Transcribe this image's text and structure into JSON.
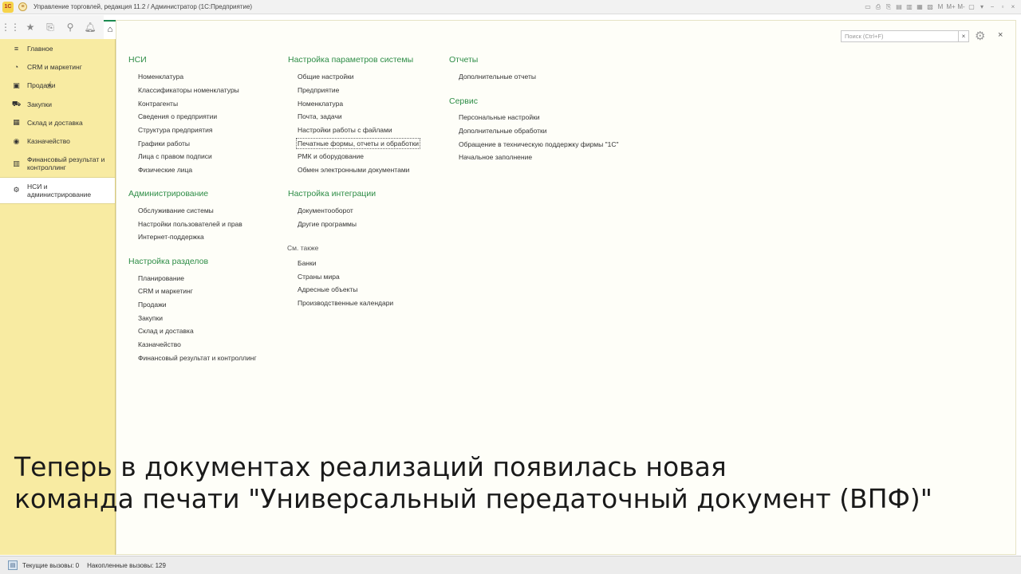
{
  "titlebar": {
    "logo": "1С",
    "title": "Управление торговлей, редакция 11.2 / Администратор  (1С:Предприятие)",
    "icons": [
      "▭",
      "⎙",
      "⎘",
      "▤",
      "▥",
      "▦",
      "▧",
      "M",
      "M+",
      "M-",
      "▢",
      "▾",
      "−",
      "▫",
      "×"
    ]
  },
  "toolbar": {
    "icons": [
      "apps-icon",
      "star-icon",
      "history-icon",
      "search-icon",
      "bell-icon"
    ]
  },
  "sidebar": {
    "items": [
      {
        "label": "Главное",
        "icon": "≡"
      },
      {
        "label": "CRM и маркетинг",
        "icon": "◔"
      },
      {
        "label": "Продажи",
        "icon": "▣"
      },
      {
        "label": "Закупки",
        "icon": "⛟"
      },
      {
        "label": "Склад и доставка",
        "icon": "▦"
      },
      {
        "label": "Казначейство",
        "icon": "◉"
      },
      {
        "label": "Финансовый результат и контроллинг",
        "icon": "▥"
      },
      {
        "label": "НСИ и администрирование",
        "icon": "⚙"
      }
    ]
  },
  "search": {
    "placeholder": "Поиск (Ctrl+F)",
    "clear": "×"
  },
  "main_close": "×",
  "sections": {
    "nsi": {
      "title": "НСИ",
      "items": [
        "Номенклатура",
        "Классификаторы номенклатуры",
        "Контрагенты",
        "Сведения о предприятии",
        "Структура предприятия",
        "Графики работы",
        "Лица с правом подписи",
        "Физические лица"
      ]
    },
    "admin": {
      "title": "Администрирование",
      "items": [
        "Обслуживание системы",
        "Настройки пользователей и прав",
        "Интернет-поддержка"
      ]
    },
    "razdely": {
      "title": "Настройка разделов",
      "items": [
        "Планирование",
        "CRM и маркетинг",
        "Продажи",
        "Закупки",
        "Склад и доставка",
        "Казначейство",
        "Финансовый результат и контроллинг"
      ]
    },
    "params": {
      "title": "Настройка параметров системы",
      "items": [
        "Общие настройки",
        "Предприятие",
        "Номенклатура",
        "Почта, задачи",
        "Настройки работы с файлами",
        "Печатные формы, отчеты и обработки",
        "РМК и оборудование",
        "Обмен электронными документами"
      ]
    },
    "integr": {
      "title": "Настройка интеграции",
      "items": [
        "Документооборот",
        "Другие программы"
      ]
    },
    "see_also": {
      "title": "См. также",
      "items": [
        "Банки",
        "Страны мира",
        "Адресные объекты",
        "Производственные календари"
      ]
    },
    "reports": {
      "title": "Отчеты",
      "items": [
        "Дополнительные отчеты"
      ]
    },
    "service": {
      "title": "Сервис",
      "items": [
        "Персональные настройки",
        "Дополнительные обработки",
        "Обращение в техническую поддержку фирмы \"1С\"",
        "Начальное заполнение"
      ]
    }
  },
  "caption": {
    "line1": "Теперь в документах реализаций появилась новая",
    "line2": "команда печати \"Универсальный передаточный документ (ВПФ)\""
  },
  "status": {
    "current_calls": "Текущие вызовы: 0",
    "accum_calls": "Накопленные вызовы: 129"
  }
}
